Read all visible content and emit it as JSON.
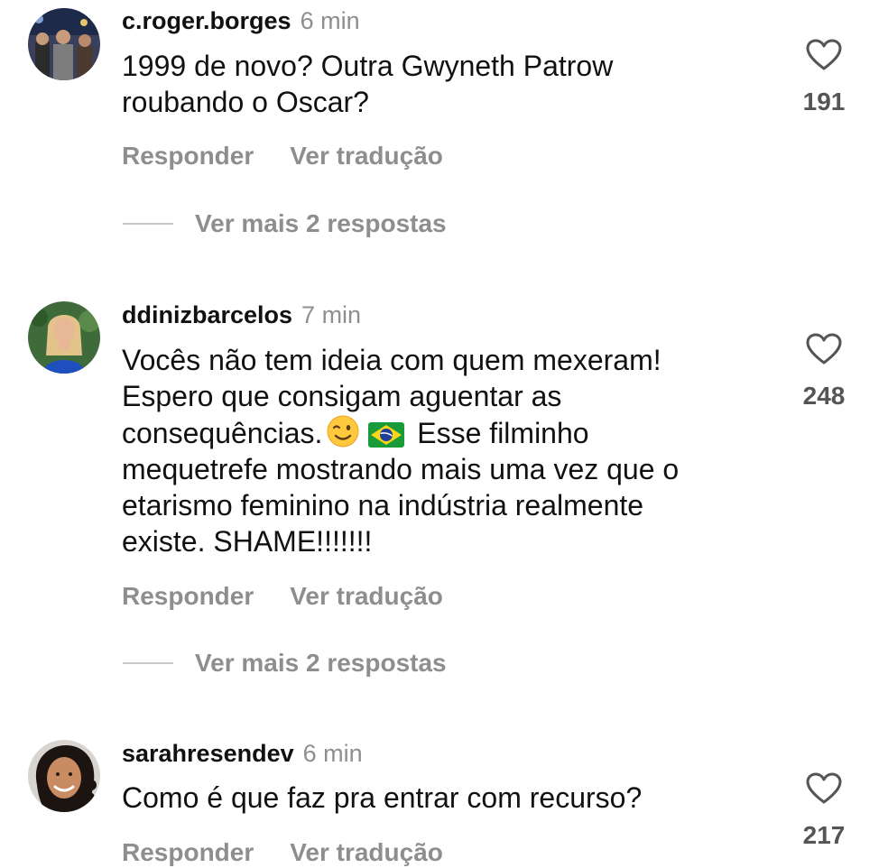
{
  "comments": [
    {
      "username": "c.roger.borges",
      "time": "6 min",
      "lines": [
        "1999 de novo? Outra Gwyneth Patrow",
        "roubando o Oscar?"
      ],
      "likes": "191",
      "reply_label": "Responder",
      "translate_label": "Ver tradução",
      "more_replies": "Ver mais 2 respostas",
      "avatar_icon": "avatar-photo-crowd"
    },
    {
      "username": "ddinizbarcelos",
      "time": "7 min",
      "lines": [
        "Vocês não tem ideia com quem mexeram!",
        "Espero que consigam aguentar as",
        "Esse filminho",
        "mequetrefe mostrando mais uma vez que o",
        "etarismo feminino na indústria realmente",
        "existe. SHAME!!!!!!!"
      ],
      "line3_prefix": "consequências.",
      "emojis": [
        "winking-face-emoji",
        "brazil-flag-emoji"
      ],
      "likes": "248",
      "reply_label": "Responder",
      "translate_label": "Ver tradução",
      "more_replies": "Ver mais 2 respostas",
      "avatar_icon": "avatar-photo-blonde-woman"
    },
    {
      "username": "sarahresendev",
      "time": "6 min",
      "lines": [
        "Como é que faz pra entrar com recurso?"
      ],
      "likes": "217",
      "reply_label": "Responder",
      "translate_label": "Ver tradução",
      "avatar_icon": "avatar-photo-curly-hair-woman"
    }
  ],
  "colors": {
    "text": "#111111",
    "muted": "#8e8e8e",
    "like_count": "#555555"
  }
}
